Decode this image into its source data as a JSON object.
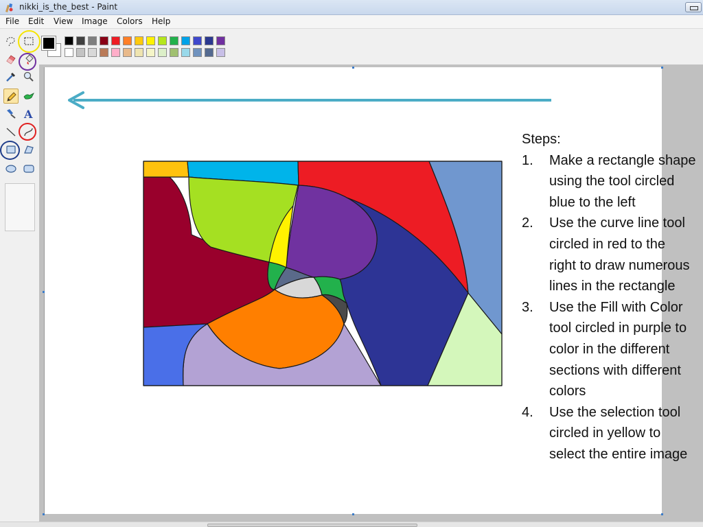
{
  "window": {
    "title": "nikki_is_the_best - Paint"
  },
  "menu": [
    "File",
    "Edit",
    "View",
    "Image",
    "Colors",
    "Help"
  ],
  "toolbox": {
    "tools": [
      "free-form-select",
      "select",
      "eraser",
      "fill-with-color",
      "pick-color",
      "magnifier",
      "pencil",
      "brush",
      "airbrush",
      "text",
      "line",
      "curve",
      "rectangle",
      "polygon",
      "ellipse",
      "rounded-rectangle"
    ],
    "active_tool": "pencil",
    "highlights": {
      "select": "#f5e400",
      "fill-with-color": "#7030a0",
      "curve": "#e02020",
      "rectangle": "#1f3d8a"
    }
  },
  "palette": {
    "foreground": "#000000",
    "background": "#ffffff",
    "row1": [
      "#000000",
      "#404040",
      "#7f7f7f",
      "#880015",
      "#ed1c24",
      "#ff7f27",
      "#ffc90e",
      "#fff200",
      "#b5e61d",
      "#22b14c",
      "#00a2e8",
      "#3f48cc",
      "#2b3990",
      "#7030a0"
    ],
    "row2": [
      "#ffffff",
      "#c3c3c3",
      "#d8d8d8",
      "#b97a57",
      "#ffaec9",
      "#e8b98a",
      "#efe4b0",
      "#f5f5c8",
      "#dcefc8",
      "#a0c070",
      "#99d9ea",
      "#7092be",
      "#546a90",
      "#c8bfe7"
    ]
  },
  "steps": {
    "title": "Steps:",
    "items": [
      {
        "num": "1.",
        "lines": [
          "Make a rectangle shape",
          "using the tool circled",
          "blue to the left"
        ]
      },
      {
        "num": "2.",
        "lines": [
          "Use the curve line tool",
          "circled in red to the",
          "right to draw numerous",
          "lines in the rectangle"
        ]
      },
      {
        "num": "3.",
        "lines": [
          "Use the Fill with Color",
          "tool circled in purple to",
          "color in the different",
          "sections with different",
          "colors"
        ]
      },
      {
        "num": "4.",
        "lines": [
          "Use the selection tool",
          "circled in yellow to",
          "select the entire image"
        ]
      }
    ]
  },
  "artwork": {
    "colors": {
      "outline": "#1a1a1a",
      "dark_red": "#99002c",
      "lime": "#a5e022",
      "sky": "#00b4ea",
      "yellow_orange": "#ffc20e",
      "red": "#ed1c24",
      "steel": "#7097cf",
      "navy": "#2d3495",
      "purple": "#7032a0",
      "yellow": "#fff200",
      "green": "#22b14c",
      "light_grey": "#d8d8d8",
      "slate": "#5a6a8a",
      "dark_grey": "#4a4a4a",
      "orange": "#ff7f00",
      "lavender": "#b3a2d4",
      "blue": "#4a6fe8",
      "pale_green": "#d4f7bb"
    },
    "arrow_color": "#4bacc6"
  }
}
